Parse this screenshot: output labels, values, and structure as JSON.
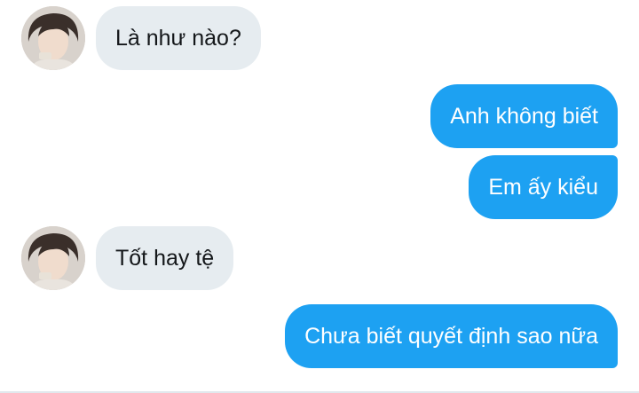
{
  "messages": [
    {
      "side": "incoming",
      "text": "Là như nào?"
    },
    {
      "side": "outgoing",
      "text": "Anh không biết"
    },
    {
      "side": "outgoing",
      "text": "Em ấy kiểu"
    },
    {
      "side": "incoming",
      "text": "Tốt hay tệ"
    },
    {
      "side": "outgoing",
      "text": "Chưa biết quyết định sao nữa"
    }
  ],
  "colors": {
    "outgoing_bubble": "#1da1f2",
    "incoming_bubble": "#e6ecf0",
    "incoming_text": "#14171a",
    "outgoing_text": "#ffffff"
  }
}
